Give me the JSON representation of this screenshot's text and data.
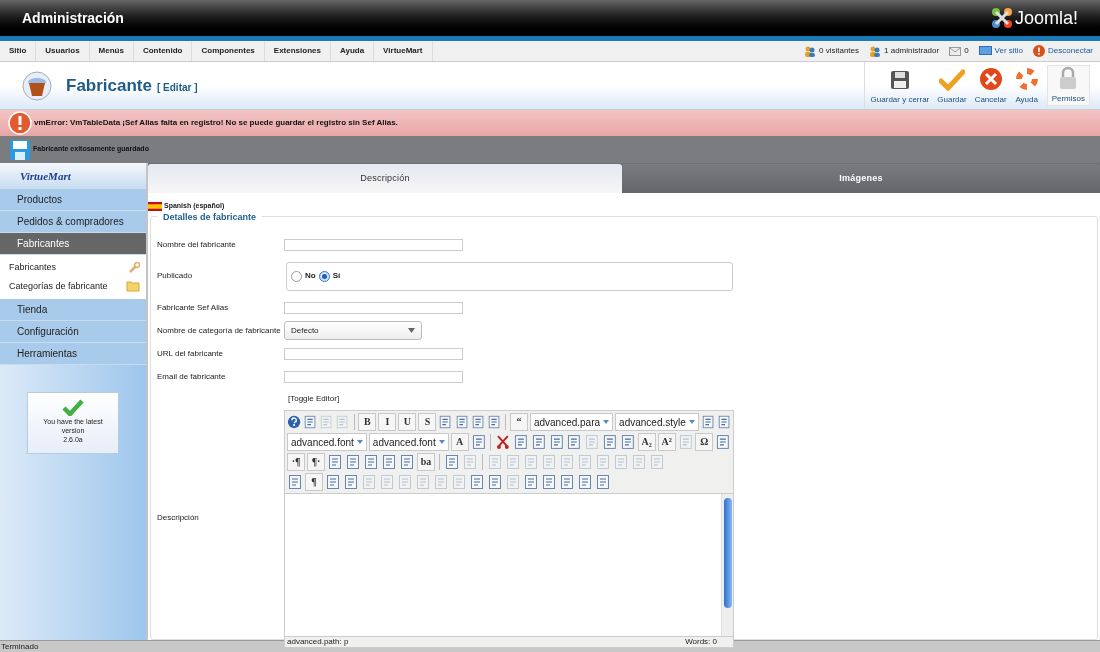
{
  "header": {
    "title": "Administración",
    "logo_text": "Joomla!"
  },
  "menu": [
    {
      "label": "Sitio"
    },
    {
      "label": "Usuarios"
    },
    {
      "label": "Menús"
    },
    {
      "label": "Contenido"
    },
    {
      "label": "Componentes"
    },
    {
      "label": "Extensiones"
    },
    {
      "label": "Ayuda"
    },
    {
      "label": "VirtueMart"
    }
  ],
  "status_links": [
    {
      "kind": "visitors",
      "label": "0 visitantes"
    },
    {
      "kind": "admins",
      "label": "1 administrador"
    },
    {
      "kind": "messages",
      "label": "0"
    },
    {
      "kind": "view",
      "label": "Ver sitio"
    },
    {
      "kind": "logout",
      "label": "Desconectar"
    }
  ],
  "page": {
    "title": "Fabricante",
    "subtitle": "[ Editar ]"
  },
  "actions": [
    {
      "kind": "save-close",
      "label": "Guardar y cerrar"
    },
    {
      "kind": "save",
      "label": "Guardar"
    },
    {
      "kind": "cancel",
      "label": "Cancelar"
    },
    {
      "kind": "help",
      "label": "Ayuda"
    },
    {
      "kind": "permissions",
      "label": "Permisos"
    }
  ],
  "error": "vmError: VmTableData ¡Sef Alias falta en registro! No se puede guardar el registro sin Sef Alias.",
  "message": "Fabricante exitosamente guardado",
  "sidebar": {
    "logo": "VirtueMart",
    "sections": [
      {
        "label": "Productos",
        "selected": false
      },
      {
        "label": "Pedidos & compradores",
        "selected": false
      },
      {
        "label": "Fabricantes",
        "selected": true,
        "children": [
          {
            "label": "Fabricantes",
            "kind": "wrench"
          },
          {
            "label": "Categorías de fabricante",
            "kind": "folder"
          }
        ]
      },
      {
        "label": "Tienda",
        "selected": false
      },
      {
        "label": "Configuración",
        "selected": false
      },
      {
        "label": "Herramientas",
        "selected": false
      }
    ],
    "version_box": {
      "text": "You have the latest version",
      "version": "2.6.0a"
    }
  },
  "tabs": [
    {
      "label": "Descripción",
      "selected": true
    },
    {
      "label": "Imágenes",
      "selected": false
    }
  ],
  "language": "Spanish (español)",
  "fieldset": {
    "legend": "Detalles de fabricante",
    "fields": [
      {
        "kind": "text",
        "label": "Nombre del fabricante"
      },
      {
        "kind": "radio",
        "label": "Publicado",
        "options": [
          {
            "label": "No",
            "selected": false
          },
          {
            "label": "Sí",
            "selected": true
          }
        ]
      },
      {
        "kind": "text",
        "label": "Fabricante Sef Alias"
      },
      {
        "kind": "select",
        "label": "Nombre de categoría de fabricante",
        "value": "Defecto"
      },
      {
        "kind": "text",
        "label": "URL del fabricante"
      },
      {
        "kind": "text",
        "label": "Email de fabricante"
      }
    ]
  },
  "editor": {
    "label": "Descripción",
    "toggle": "[Toggle Editor]",
    "path": "advanced.path: p",
    "words": "Words: 0",
    "toolbar": [
      [
        {
          "kind": "help"
        },
        {
          "kind": "icon",
          "disabled": false
        },
        {
          "kind": "icon",
          "disabled": true
        },
        {
          "kind": "icon",
          "disabled": true
        },
        {
          "kind": "sep"
        },
        {
          "kind": "glyph",
          "label": "B"
        },
        {
          "kind": "glyph",
          "label": "I"
        },
        {
          "kind": "glyph",
          "label": "U"
        },
        {
          "kind": "glyph",
          "label": "S"
        },
        {
          "kind": "icon",
          "disabled": false
        },
        {
          "kind": "icon",
          "disabled": false
        },
        {
          "kind": "icon",
          "disabled": false
        },
        {
          "kind": "icon",
          "disabled": false
        },
        {
          "kind": "sep"
        },
        {
          "kind": "glyph",
          "label": "“"
        },
        {
          "kind": "select",
          "label": "advanced.para"
        },
        {
          "kind": "select",
          "label": "advanced.style"
        },
        {
          "kind": "icon",
          "disabled": false
        },
        {
          "kind": "icon",
          "disabled": false
        }
      ],
      [
        {
          "kind": "select",
          "label": "advanced.font"
        },
        {
          "kind": "select",
          "label": "advanced.font"
        },
        {
          "kind": "glyph",
          "label": "A"
        },
        {
          "kind": "icon",
          "disabled": false
        },
        {
          "kind": "sep"
        },
        {
          "kind": "cut"
        },
        {
          "kind": "icon",
          "disabled": false
        },
        {
          "kind": "icon",
          "disabled": false
        },
        {
          "kind": "icon",
          "disabled": false
        },
        {
          "kind": "icon",
          "disabled": false
        },
        {
          "kind": "icon",
          "disabled": true
        },
        {
          "kind": "icon",
          "disabled": false
        },
        {
          "kind": "icon",
          "disabled": false
        },
        {
          "kind": "glyph",
          "label": "A₂"
        },
        {
          "kind": "glyph",
          "label": "A²"
        },
        {
          "kind": "icon",
          "disabled": true
        },
        {
          "kind": "glyph",
          "label": "Ω"
        },
        {
          "kind": "icon",
          "disabled": false
        }
      ],
      [
        {
          "kind": "glyph",
          "label": "·¶"
        },
        {
          "kind": "glyph",
          "label": "¶·"
        },
        {
          "kind": "icon",
          "disabled": false
        },
        {
          "kind": "icon",
          "disabled": false
        },
        {
          "kind": "icon",
          "disabled": false
        },
        {
          "kind": "icon",
          "disabled": false
        },
        {
          "kind": "icon",
          "disabled": false
        },
        {
          "kind": "glyph",
          "label": "ba"
        },
        {
          "kind": "sep"
        },
        {
          "kind": "icon",
          "disabled": false
        },
        {
          "kind": "icon",
          "disabled": true
        },
        {
          "kind": "sep"
        },
        {
          "kind": "icon",
          "disabled": true
        },
        {
          "kind": "icon",
          "disabled": true
        },
        {
          "kind": "icon",
          "disabled": true
        },
        {
          "kind": "icon",
          "disabled": true
        },
        {
          "kind": "icon",
          "disabled": true
        },
        {
          "kind": "icon",
          "disabled": true
        },
        {
          "kind": "icon",
          "disabled": true
        },
        {
          "kind": "icon",
          "disabled": true
        },
        {
          "kind": "icon",
          "disabled": true
        },
        {
          "kind": "icon",
          "disabled": true
        }
      ],
      [
        {
          "kind": "icon",
          "disabled": false
        },
        {
          "kind": "glyph",
          "label": "¶"
        },
        {
          "kind": "icon",
          "disabled": false
        },
        {
          "kind": "icon",
          "disabled": false
        },
        {
          "kind": "icon",
          "disabled": true
        },
        {
          "kind": "icon",
          "disabled": true
        },
        {
          "kind": "icon",
          "disabled": true
        },
        {
          "kind": "icon",
          "disabled": true
        },
        {
          "kind": "icon",
          "disabled": true
        },
        {
          "kind": "icon",
          "disabled": true
        },
        {
          "kind": "icon",
          "disabled": false
        },
        {
          "kind": "icon",
          "disabled": false
        },
        {
          "kind": "icon",
          "disabled": true
        },
        {
          "kind": "icon",
          "disabled": false
        },
        {
          "kind": "icon",
          "disabled": false
        },
        {
          "kind": "icon",
          "disabled": false
        },
        {
          "kind": "icon",
          "disabled": false
        },
        {
          "kind": "icon",
          "disabled": false
        }
      ]
    ]
  },
  "status_bar": "Terminado"
}
